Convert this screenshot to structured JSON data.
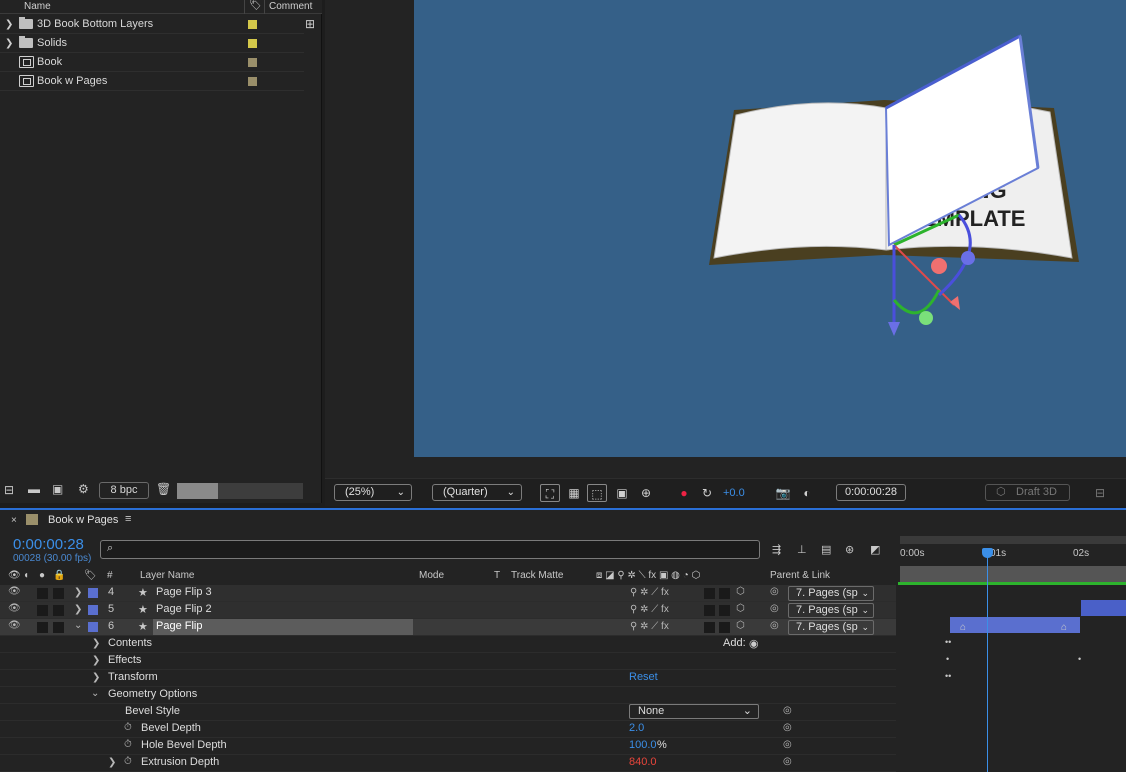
{
  "project": {
    "columns": {
      "name": "Name",
      "comment": "Comment"
    },
    "items": [
      {
        "label": "3D Book Bottom Layers",
        "type": "folder",
        "color": "#d4c84a",
        "expandable": true
      },
      {
        "label": "Solids",
        "type": "folder",
        "color": "#d4c84a",
        "expandable": true
      },
      {
        "label": "Book",
        "type": "comp",
        "color": "#9a8f6a",
        "expandable": false
      },
      {
        "label": "Book w Pages",
        "type": "comp",
        "color": "#9a8f6a",
        "expandable": false
      }
    ],
    "bpc": "8 bpc"
  },
  "viewer": {
    "book_text_1": "TING",
    "book_text_2": "EMPLATE",
    "canvas_color": "#356088"
  },
  "viewer_toolbar": {
    "zoom": "(25%)",
    "resolution": "(Quarter)",
    "exposure": "+0.0",
    "timecode": "0:00:00:28",
    "renderer": "Draft 3D"
  },
  "timeline": {
    "tab_title": "Book w Pages",
    "timecode": "0:00:00:28",
    "frame_info": "00028 (30.00 fps)",
    "ruler": [
      "0:00s",
      "01s",
      "02s"
    ],
    "columns": {
      "num": "#",
      "layer_name": "Layer Name",
      "mode": "Mode",
      "t": "T",
      "track_matte": "Track Matte",
      "parent": "Parent & Link"
    },
    "layers": [
      {
        "num": "4",
        "name": "Page Flip 3",
        "parent": "7. Pages (sp",
        "color": "#5a6fcf"
      },
      {
        "num": "5",
        "name": "Page Flip 2",
        "parent": "7. Pages (sp",
        "color": "#5a6fcf"
      },
      {
        "num": "6",
        "name": "Page Flip",
        "parent": "7. Pages (sp",
        "color": "#5a6fcf"
      }
    ],
    "properties": {
      "contents": "Contents",
      "add_label": "Add:",
      "effects": "Effects",
      "transform": "Transform",
      "reset": "Reset",
      "geometry": "Geometry Options",
      "bevel_style": "Bevel Style",
      "bevel_style_value": "None",
      "bevel_depth": "Bevel Depth",
      "bevel_depth_value": "2.0",
      "hole_bevel": "Hole Bevel Depth",
      "hole_bevel_value": "100.0",
      "hole_bevel_unit": "%",
      "extrusion": "Extrusion Depth",
      "extrusion_value": "840.0"
    }
  }
}
